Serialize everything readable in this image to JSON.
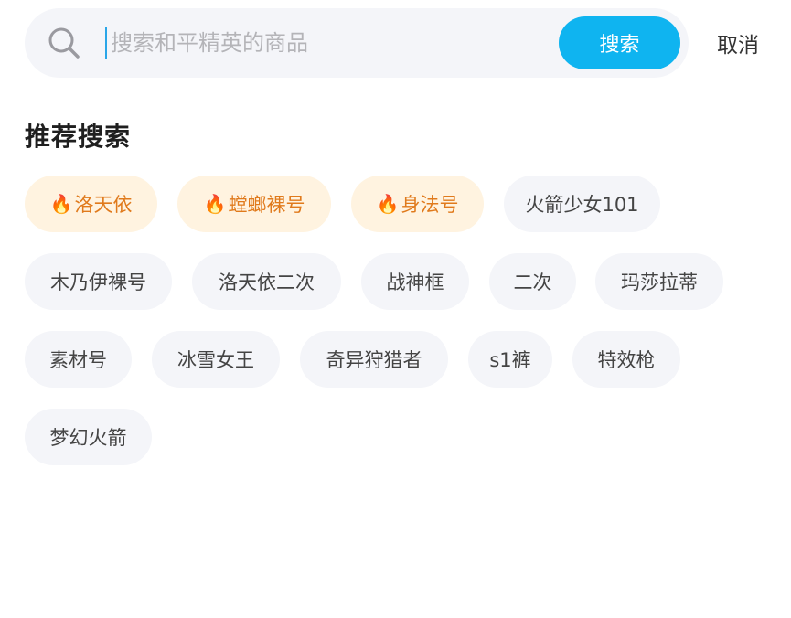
{
  "search": {
    "placeholder": "搜索和平精英的商品",
    "value": "",
    "button_label": "搜索",
    "cancel_label": "取消"
  },
  "recommend": {
    "title": "推荐搜索",
    "tags": [
      {
        "label": "洛天依",
        "hot": true
      },
      {
        "label": "螳螂裸号",
        "hot": true
      },
      {
        "label": "身法号",
        "hot": true
      },
      {
        "label": "火箭少女101",
        "hot": false
      },
      {
        "label": "木乃伊裸号",
        "hot": false
      },
      {
        "label": "洛天依二次",
        "hot": false
      },
      {
        "label": "战神框",
        "hot": false
      },
      {
        "label": "二次",
        "hot": false
      },
      {
        "label": "玛莎拉蒂",
        "hot": false
      },
      {
        "label": "素材号",
        "hot": false
      },
      {
        "label": "冰雪女王",
        "hot": false
      },
      {
        "label": "奇异狩猎者",
        "hot": false
      },
      {
        "label": "s1裤",
        "hot": false
      },
      {
        "label": "特效枪",
        "hot": false
      },
      {
        "label": "梦幻火箭",
        "hot": false
      }
    ]
  },
  "colors": {
    "accent": "#0fb4f0",
    "hot_text": "#e07a1c",
    "hot_bg": "#fff3e0",
    "chip_bg": "#f4f5f9"
  },
  "icons": {
    "search": "search-icon",
    "hot": "flame-icon"
  }
}
